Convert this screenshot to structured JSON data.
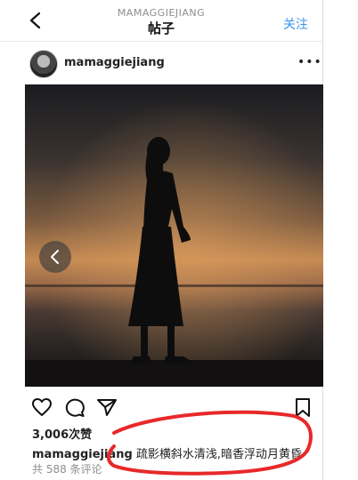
{
  "header": {
    "username": "MAMAGGIEJIANG",
    "title": "帖子",
    "follow_label": "关注"
  },
  "post": {
    "username": "mamaggiejiang",
    "likes": "3,006次赞",
    "caption_user": "mamaggiejiang",
    "caption_text": "疏影横斜水清浅,暗香浮动月黄昏",
    "comments": "共 588 条评论"
  },
  "icons": {
    "back": "chevron-left-icon",
    "more": "more-dots-icon",
    "like": "heart-icon",
    "comment": "comment-icon",
    "share": "send-icon",
    "save": "bookmark-icon",
    "prev": "carousel-prev-icon"
  },
  "colors": {
    "link": "#3897f0",
    "annotation": "#e8282a"
  }
}
